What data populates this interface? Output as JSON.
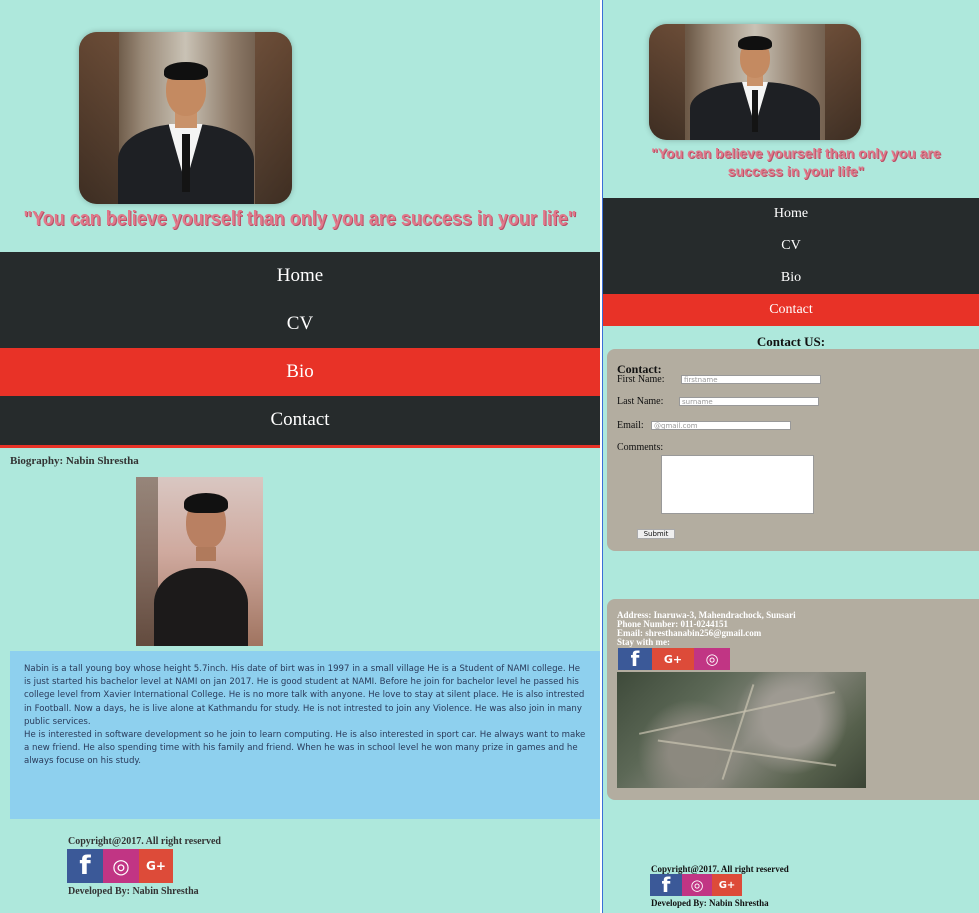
{
  "quote": "\"You can believe yourself than only you are success in your life\"",
  "quote_right_line1": "\"You can believe yourself than only you are",
  "quote_right_line2": "success in your life\"",
  "nav": {
    "home": "Home",
    "cv": "CV",
    "bio": "Bio",
    "contact": "Contact"
  },
  "bio": {
    "title": "Biography: Nabin Shrestha",
    "paragraph1": "Nabin is a tall young boy whose height 5.7inch. His date of birt was in 1997 in a small village He is a Student of NAMI college. He is just started his bachelor level at NAMI on jan 2017. He is good student at NAMI. Before he join for bachelor level he passed his college level from Xavier International College. He is no more talk with anyone. He love to stay at silent place. He is also intrested in Football. Now a days, he is live alone at Kathmandu for study. He is not intrested to join any Violence. He was also join in many public services.",
    "paragraph2": "He is interested in software development so he join to learn computing. He is also interested in sport car. He always want to make a new friend. He also spending time with his family and friend. When he was in school level he won many prize in games and he always focuse on his study."
  },
  "footer": {
    "copyright": "Copyright@2017. All right reserved",
    "developed_by": "Developed By: Nabin Shrestha"
  },
  "contact": {
    "heading": "Contact US:",
    "form_title": "Contact:",
    "first_name_label": "First Name:",
    "first_name_placeholder": "firstname",
    "last_name_label": "Last Name:",
    "last_name_placeholder": "surname",
    "email_label": "Email:",
    "email_placeholder": "@gmail.com",
    "comments_label": "Comments:",
    "submit_label": "Submit"
  },
  "info": {
    "address": "Address: Inaruwa-3, Mahendrachock, Sunsari",
    "phone": "Phone Number: 011-0244151",
    "email": "Email: shresthanabin256@gmail.com",
    "stay": "Stay with me:"
  },
  "social": {
    "facebook_glyph": "f",
    "instagram_glyph": "◎",
    "googleplus_glyph": "G+"
  },
  "colors": {
    "background": "#aee8dc",
    "nav": "#262b2c",
    "active": "#e83227",
    "quote": "#e0788a",
    "bio_box": "#8ed0ee",
    "panel_box": "#b3ada0"
  }
}
